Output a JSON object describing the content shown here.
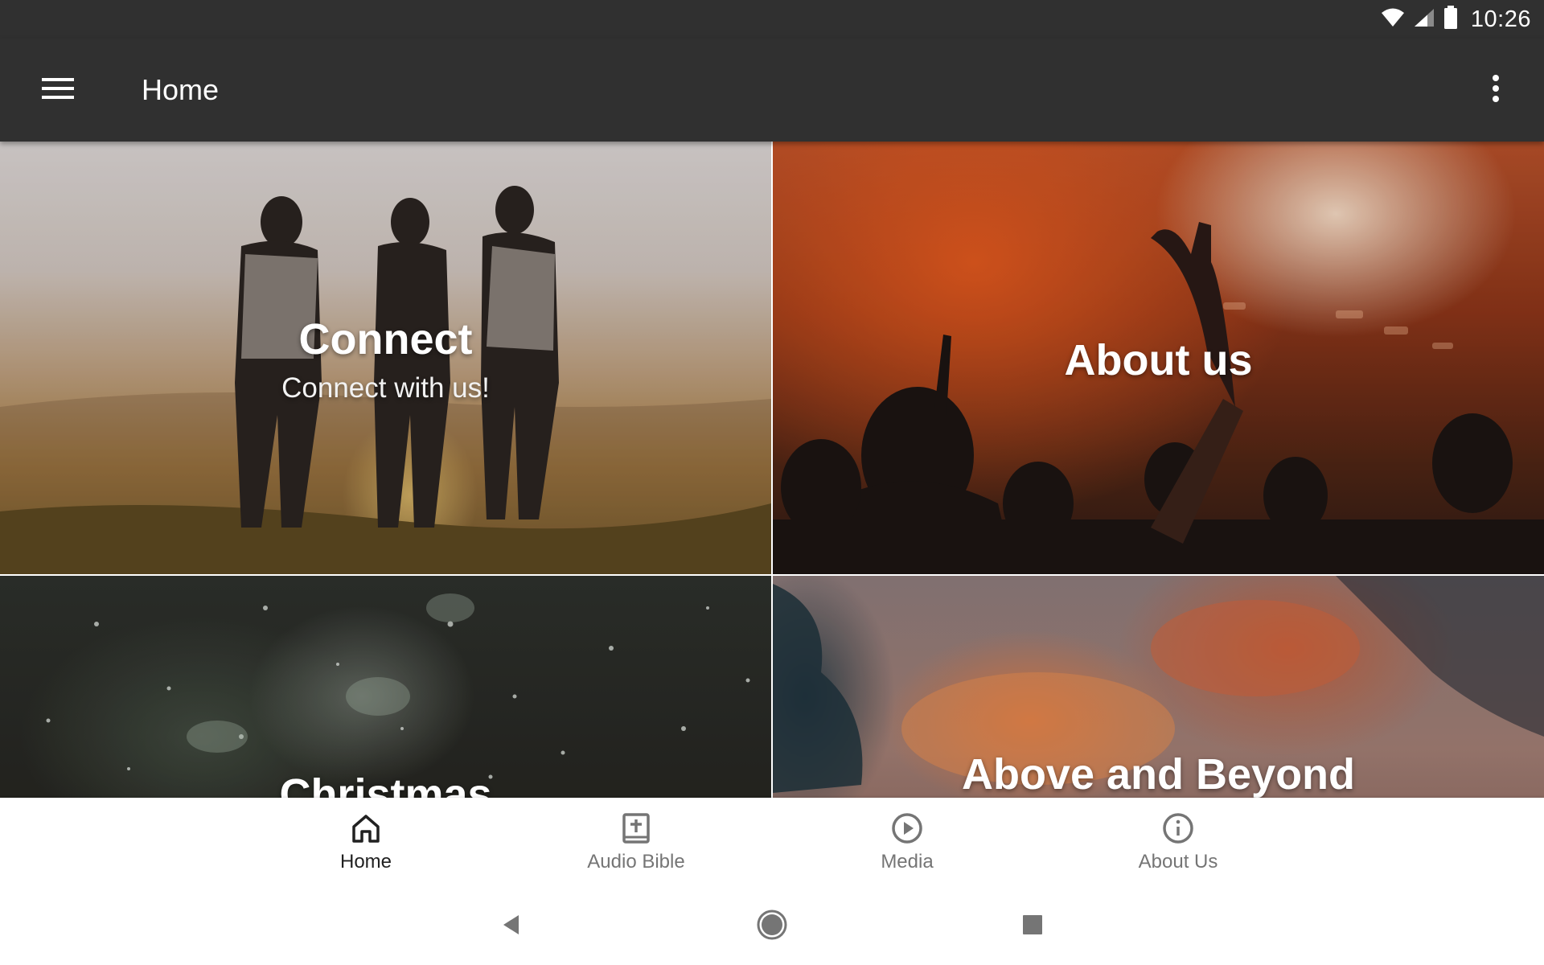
{
  "status_bar": {
    "time": "10:26",
    "icons": [
      "wifi-icon",
      "cellular-signal-icon",
      "battery-icon"
    ]
  },
  "app_bar": {
    "title": "Home",
    "menu_icon": "hamburger-menu-icon",
    "overflow_icon": "more-vert-icon"
  },
  "tiles": [
    {
      "id": "connect",
      "title": "Connect",
      "subtitle": "Connect with us!"
    },
    {
      "id": "about-us",
      "title": "About us",
      "subtitle": ""
    },
    {
      "id": "christmas",
      "title": "Christmas",
      "subtitle": ""
    },
    {
      "id": "above-and-beyond",
      "title": "Above and Beyond",
      "subtitle": ""
    }
  ],
  "bottom_nav": {
    "items": [
      {
        "label": "Home",
        "icon": "home-icon",
        "active": true
      },
      {
        "label": "Audio Bible",
        "icon": "audio-bible-icon",
        "active": false
      },
      {
        "label": "Media",
        "icon": "play-circle-icon",
        "active": false
      },
      {
        "label": "About Us",
        "icon": "info-icon",
        "active": false
      }
    ]
  },
  "system_nav": {
    "buttons": [
      "back-icon",
      "home-circle-icon",
      "recents-icon"
    ]
  },
  "colors": {
    "app_bar_bg": "#303030",
    "status_bar_bg": "#303030",
    "nav_active_text": "#212121",
    "nav_inactive_text": "#757575",
    "system_nav_icon": "#757575"
  }
}
